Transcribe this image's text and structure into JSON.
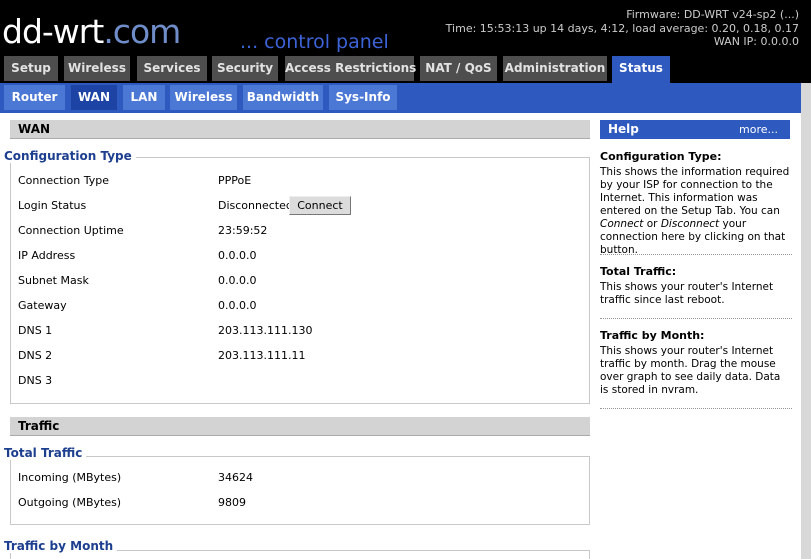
{
  "header": {
    "logo_main": "dd-wrt",
    "logo_suffix": ".com",
    "subtitle": "... control panel",
    "firmware": "Firmware: DD-WRT v24-sp2 (...)",
    "time": "Time: 15:53:13 up 14 days, 4:12, load average: 0.20, 0.18, 0.17",
    "wan_ip": "WAN IP: 0.0.0.0"
  },
  "main_tabs": [
    "Setup",
    "Wireless",
    "Services",
    "Security",
    "Access Restrictions",
    "NAT / QoS",
    "Administration",
    "Status"
  ],
  "sub_tabs": [
    "Router",
    "WAN",
    "LAN",
    "Wireless",
    "Bandwidth",
    "Sys-Info"
  ],
  "wan": {
    "section_title": "WAN",
    "config_legend": "Configuration Type",
    "rows": [
      {
        "label": "Connection Type",
        "value": "PPPoE"
      },
      {
        "label": "Login Status",
        "value": "Disconnected"
      },
      {
        "label": "Connection Uptime",
        "value": "23:59:52"
      },
      {
        "label": "IP Address",
        "value": "0.0.0.0"
      },
      {
        "label": "Subnet Mask",
        "value": "0.0.0.0"
      },
      {
        "label": "Gateway",
        "value": "0.0.0.0"
      },
      {
        "label": "DNS 1",
        "value": "203.113.111.130"
      },
      {
        "label": "DNS 2",
        "value": "203.113.111.11"
      },
      {
        "label": "DNS 3",
        "value": ""
      }
    ],
    "connect_button": "Connect"
  },
  "traffic": {
    "section_title": "Traffic",
    "total_legend": "Total Traffic",
    "rows": [
      {
        "label": "Incoming (MBytes)",
        "value": "34624"
      },
      {
        "label": "Outgoing (MBytes)",
        "value": "9809"
      }
    ],
    "month_legend": "Traffic by Month"
  },
  "help": {
    "title": "Help",
    "more": "more...",
    "blocks": [
      {
        "title": "Configuration Type:",
        "text_a": "This shows the information required by your ISP for connection to the Internet. This information was entered on the Setup Tab. You can ",
        "em1": "Connect",
        "text_b": " or ",
        "em2": "Disconnect",
        "text_c": " your connection here by clicking on that button."
      },
      {
        "title": "Total Traffic:",
        "text": "This shows your router's Internet traffic since last reboot."
      },
      {
        "title": "Traffic by Month:",
        "text": "This shows your router's Internet traffic by month. Drag the mouse over graph to see daily data. Data is stored in nvram."
      }
    ]
  },
  "colors": {
    "accent": "#2e59bf",
    "tab_inactive": "#4e4e4e",
    "legend": "#1d3f8f"
  }
}
